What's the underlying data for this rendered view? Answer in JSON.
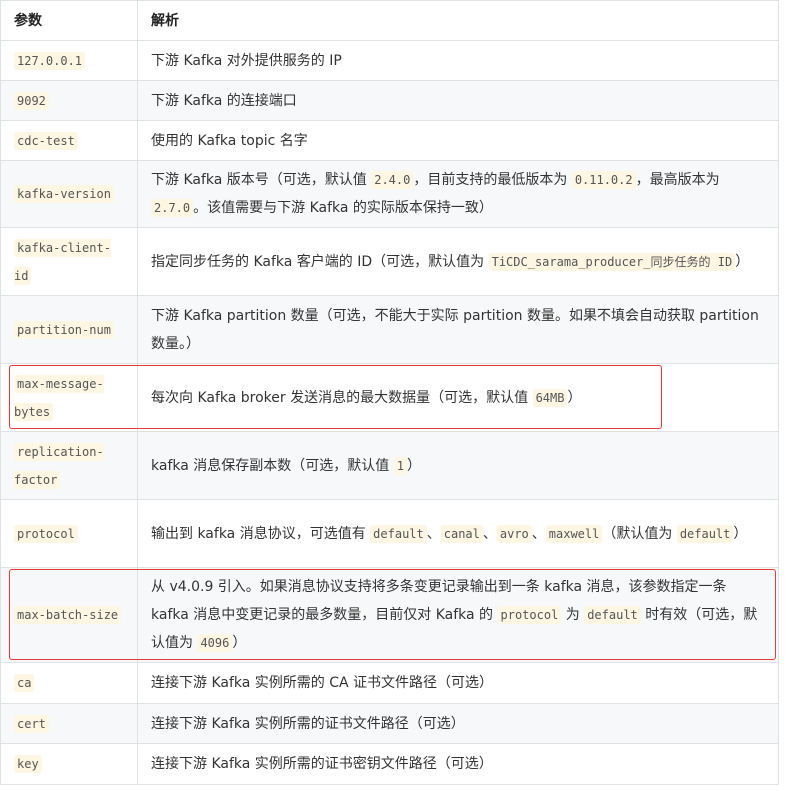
{
  "header": {
    "param": "参数",
    "desc": "解析"
  },
  "rows": [
    {
      "param": "127.0.0.1",
      "h": 41,
      "desc": [
        {
          "t": "下游 Kafka 对外提供服务的 IP"
        }
      ]
    },
    {
      "param": "9092",
      "h": 41,
      "desc": [
        {
          "t": "下游 Kafka 的连接端口"
        }
      ]
    },
    {
      "param": "cdc-test",
      "h": 41,
      "desc": [
        {
          "t": "使用的 Kafka topic 名字"
        }
      ]
    },
    {
      "param": "kafka-version",
      "h": 68,
      "desc": [
        {
          "t": "下游 Kafka 版本号（可选，默认值 "
        },
        {
          "c": "2.4.0"
        },
        {
          "t": "，目前支持的最低版本为 "
        },
        {
          "c": "0.11.0.2"
        },
        {
          "t": "，最高版本为 "
        },
        {
          "c": "2.7.0"
        },
        {
          "t": "。该值需要与下游 Kafka 的实际版本保持一致）"
        }
      ]
    },
    {
      "param": "kafka-client-id",
      "h": 69,
      "desc": [
        {
          "t": "指定同步任务的 Kafka 客户端的 ID（可选，默认值为 "
        },
        {
          "c": "TiCDC_sarama_producer_同步任务的 ID"
        },
        {
          "t": "）"
        }
      ]
    },
    {
      "param": "partition-num",
      "h": 69,
      "desc": [
        {
          "t": "下游 Kafka partition 数量（可选，不能大于实际 partition 数量。如果不填会自动获取 partition 数量。）"
        }
      ]
    },
    {
      "param": "max-message-bytes",
      "h": 69,
      "highlight": true,
      "desc": [
        {
          "t": "每次向 Kafka broker 发送消息的最大数据量（可选，默认值 "
        },
        {
          "c": "64MB"
        },
        {
          "t": "）"
        }
      ]
    },
    {
      "param": "replication-factor",
      "h": 69,
      "desc": [
        {
          "t": "kafka 消息保存副本数（可选，默认值 "
        },
        {
          "c": "1"
        },
        {
          "t": "）"
        }
      ]
    },
    {
      "param": "protocol",
      "h": 69,
      "desc": [
        {
          "t": "输出到 kafka 消息协议，可选值有 "
        },
        {
          "c": "default"
        },
        {
          "t": "、"
        },
        {
          "c": "canal"
        },
        {
          "t": "、"
        },
        {
          "c": "avro"
        },
        {
          "t": "、"
        },
        {
          "c": "maxwell"
        },
        {
          "t": "（默认值为 "
        },
        {
          "c": "default"
        },
        {
          "t": "）"
        }
      ]
    },
    {
      "param": "max-batch-size",
      "h": 96,
      "highlight": true,
      "desc": [
        {
          "t": "从 v4.0.9 引入。如果消息协议支持将多条变更记录输出到一条 kafka 消息，该参数指定一条 kafka 消息中变更记录的最多数量，目前仅对 Kafka 的 "
        },
        {
          "c": "protocol"
        },
        {
          "t": " 为 "
        },
        {
          "c": "default"
        },
        {
          "t": " 时有效（可选，默认值为 "
        },
        {
          "c": "4096"
        },
        {
          "t": "）"
        }
      ]
    },
    {
      "param": "ca",
      "h": 42,
      "desc": [
        {
          "t": "连接下游 Kafka 实例所需的 CA 证书文件路径（可选）"
        }
      ]
    },
    {
      "param": "cert",
      "h": 41,
      "desc": [
        {
          "t": "连接下游 Kafka 实例所需的证书文件路径（可选）"
        }
      ]
    },
    {
      "param": "key",
      "h": 42,
      "desc": [
        {
          "t": "连接下游 Kafka 实例所需的证书密钥文件路径（可选）"
        }
      ]
    }
  ]
}
